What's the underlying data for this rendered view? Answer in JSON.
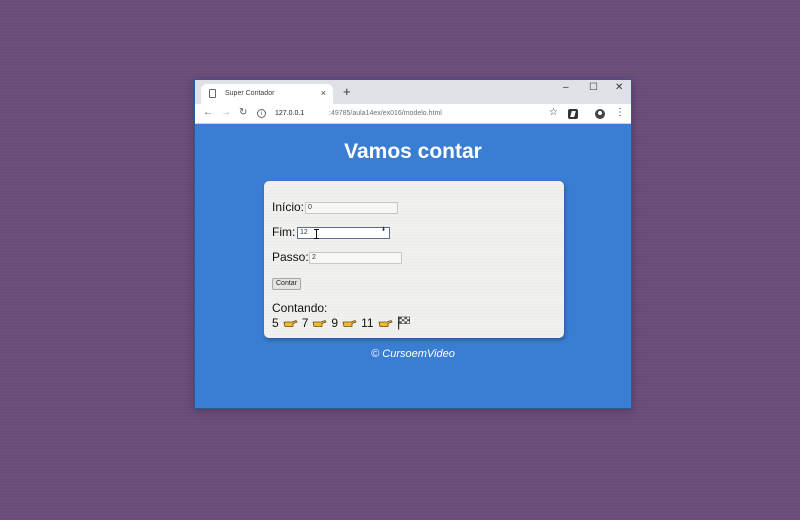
{
  "browser": {
    "tab_title": "Super Contador",
    "tab_close": "×",
    "new_tab": "+",
    "window_controls": {
      "minimize": "–",
      "maximize": "☐",
      "close": "✕"
    },
    "nav": {
      "back": "←",
      "forward": "→",
      "reload": "↻"
    },
    "url_host": "127.0.0.1",
    "url_path": ":49785/aula14ex/ex016/modelo.html",
    "tools": {
      "bookmark": "☆",
      "menu": "⋮"
    }
  },
  "page": {
    "title": "Vamos contar",
    "form": {
      "inicio_label": "Início:",
      "inicio_value": "0",
      "fim_label": "Fim:",
      "fim_value": "12",
      "passo_label": "Passo:",
      "passo_value": "2",
      "button_label": "Contar",
      "spinner": "⬍"
    },
    "result": {
      "label": "Contando:",
      "numbers": [
        "5",
        "7",
        "9",
        "11"
      ]
    },
    "footer": "© CursoemVideo"
  },
  "icons": {
    "hand": "hand-pointing-right-icon",
    "flag": "checkered-flag-icon"
  },
  "colors": {
    "desktop": "#6b4e7a",
    "page_background": "#3a7ed4",
    "card": "#f0f1ee",
    "hand": "#f0b92e"
  }
}
